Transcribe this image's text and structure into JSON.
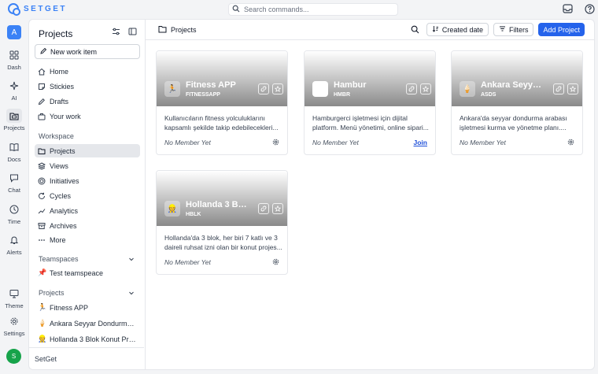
{
  "brand": {
    "name": "SETGET",
    "accent": "#3b82f6"
  },
  "search": {
    "placeholder": "Search commands..."
  },
  "rail": {
    "workspace_initial": "A",
    "items": [
      {
        "label": "Dash",
        "icon": "dashboard-icon"
      },
      {
        "label": "AI",
        "icon": "sparkles-icon"
      },
      {
        "label": "Projects",
        "icon": "folder-icon"
      },
      {
        "label": "Docs",
        "icon": "book-icon"
      },
      {
        "label": "Chat",
        "icon": "chat-icon"
      },
      {
        "label": "Time",
        "icon": "clock-icon"
      },
      {
        "label": "Alerts",
        "icon": "bell-icon"
      },
      {
        "label": "Theme",
        "icon": "monitor-icon"
      },
      {
        "label": "Settings",
        "icon": "gear-icon"
      }
    ],
    "user_initial": "S"
  },
  "sidebar": {
    "title": "Projects",
    "new_item": "New work item",
    "nav": [
      "Home",
      "Stickies",
      "Drafts",
      "Your work"
    ],
    "workspace_label": "Workspace",
    "workspace_items": [
      "Projects",
      "Views",
      "Initiatives",
      "Cycles",
      "Analytics",
      "Archives",
      "More"
    ],
    "teamspaces_label": "Teamspaces",
    "teamspaces": [
      {
        "emoji": "📌",
        "name": "Test teamspeace"
      }
    ],
    "projects_label": "Projects",
    "projects": [
      {
        "emoji": "🏃",
        "name": "Fitness APP"
      },
      {
        "emoji": "🍦",
        "name": "Ankara Seyyar Dondurma Arab..."
      },
      {
        "emoji": "👷",
        "name": "Hollanda 3 Blok Konut Proje..."
      }
    ],
    "footer": "SetGet"
  },
  "main": {
    "breadcrumb": "Projects",
    "sort_label": "Created date",
    "filters_label": "Filters",
    "add_label": "Add Project"
  },
  "cards": [
    {
      "emoji": "🏃",
      "name": "Fitness APP",
      "code": "FITNESSAPP",
      "desc1": "Kullanıcıların fitness yolculuklarını",
      "desc2": "kapsamlı şekilde takip edebilecekleri...",
      "member": "No Member Yet",
      "action": "gear"
    },
    {
      "emoji": "",
      "name": "Hambur",
      "code": "HMBR",
      "desc1": "Hamburgerci işletmesi için dijital",
      "desc2": "platform. Menü yönetimi, online sipari...",
      "member": "No Member Yet",
      "action": "join",
      "join_label": "Join"
    },
    {
      "emoji": "🍦",
      "name": "Ankara Seyyar ...",
      "code": "ASDS",
      "desc1": "Ankara'da seyyar dondurma arabası",
      "desc2": "işletmesi kurma ve yönetme planı....",
      "member": "No Member Yet",
      "action": "gear"
    },
    {
      "emoji": "👷",
      "name": "Hollanda 3 Blok...",
      "code": "HBLK",
      "desc1": "Hollanda'da 3 blok, her biri 7 katlı ve 3",
      "desc2": "daireli ruhsat izni olan bir konut projes...",
      "member": "No Member Yet",
      "action": "gear"
    }
  ]
}
